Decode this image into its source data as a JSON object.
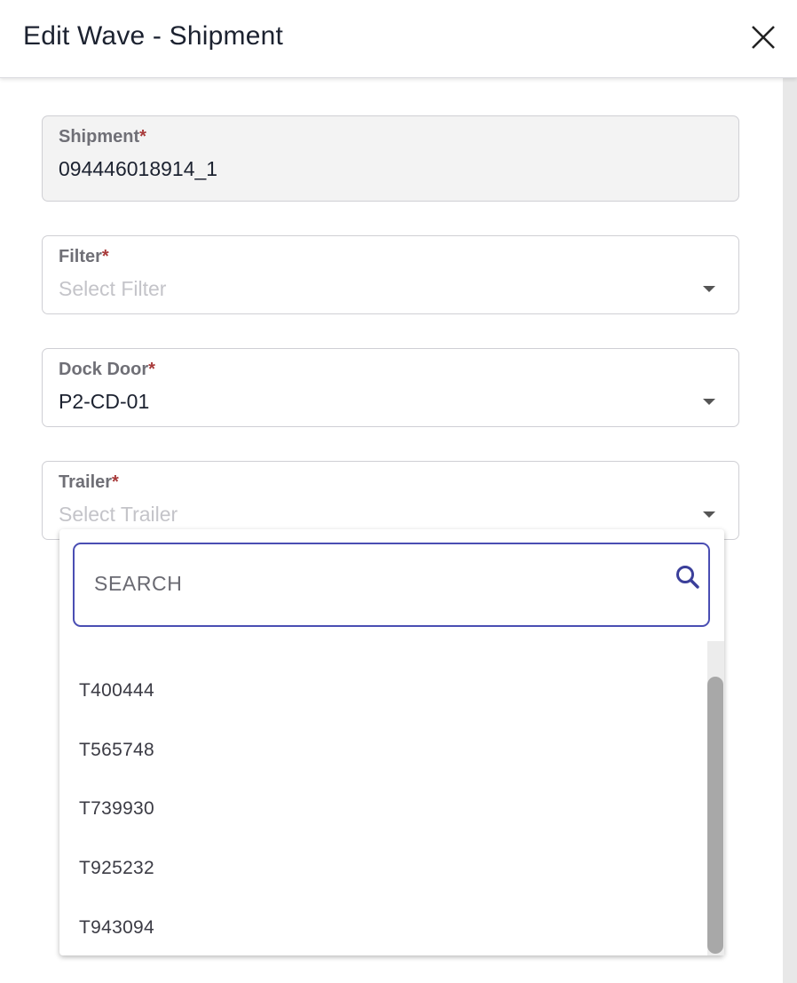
{
  "dialog": {
    "title": "Edit Wave - Shipment"
  },
  "form": {
    "required_mark": "*",
    "shipment": {
      "label": "Shipment",
      "value": "094446018914_1"
    },
    "filter": {
      "label": "Filter",
      "placeholder": "Select Filter"
    },
    "dock_door": {
      "label": "Dock Door",
      "value": "P2-CD-01"
    },
    "trailer": {
      "label": "Trailer",
      "placeholder": "Select Trailer"
    }
  },
  "trailer_dropdown": {
    "search_placeholder": "SEARCH",
    "options": [
      "T400444",
      "T565748",
      "T739930",
      "T925232",
      "T943094"
    ]
  },
  "colors": {
    "accent": "#4a4eb3",
    "required": "#a83a3a"
  }
}
